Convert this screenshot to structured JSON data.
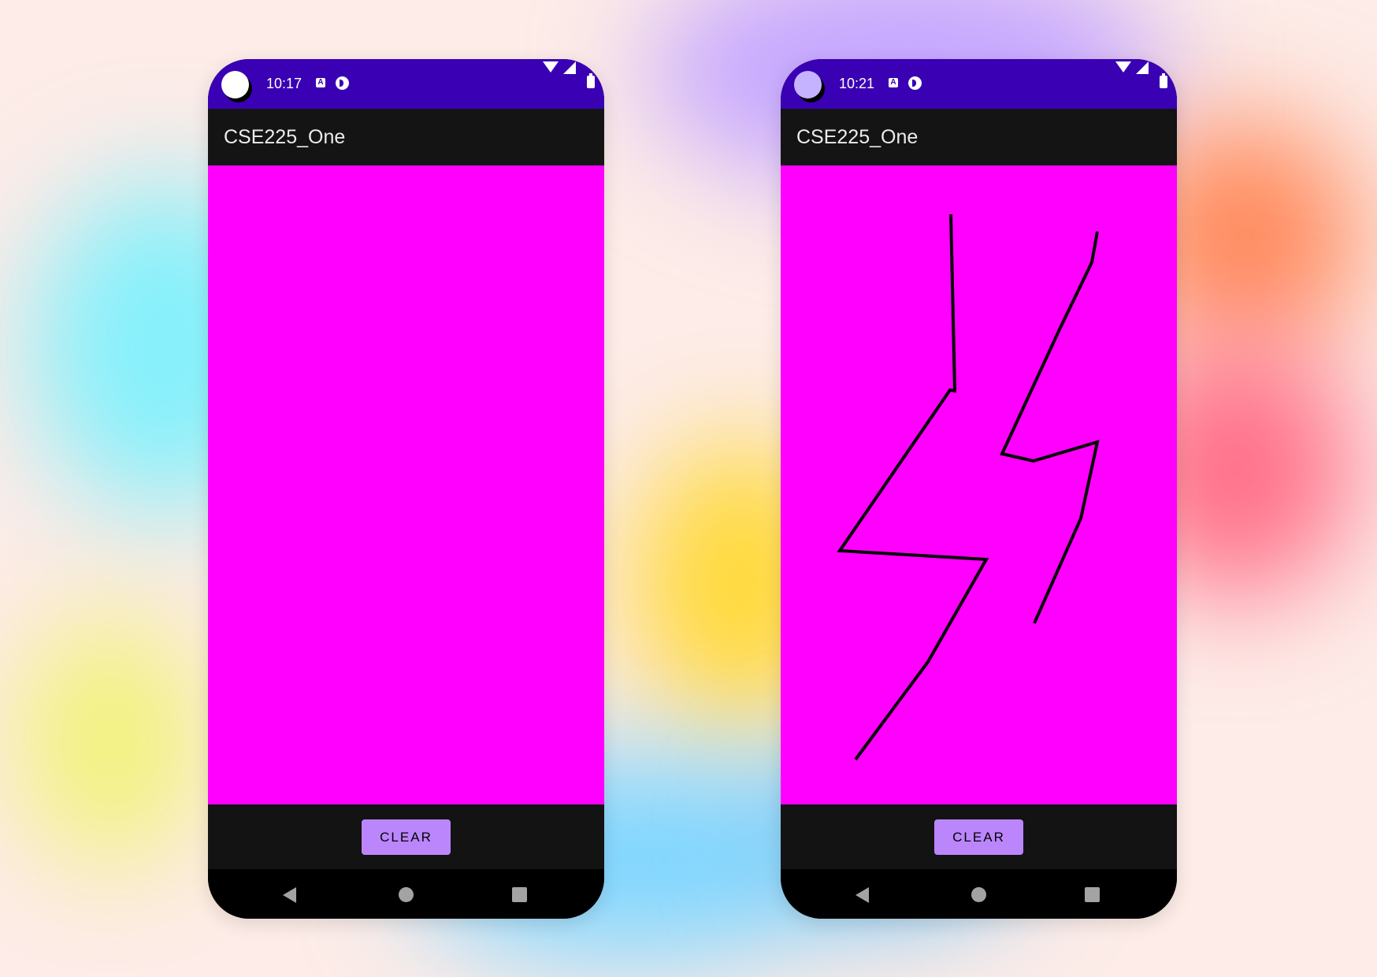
{
  "phones": [
    {
      "status_bar": {
        "time": "10:17",
        "notification_a": "A"
      },
      "app_bar": {
        "title": "CSE225_One"
      },
      "canvas": {
        "background": "#ff00ff",
        "drawing": "empty"
      },
      "bottom": {
        "clear_label": "CLEAR"
      },
      "nav": [
        "back-icon",
        "home-icon",
        "recents-icon"
      ]
    },
    {
      "status_bar": {
        "time": "10:21",
        "notification_a": "A"
      },
      "app_bar": {
        "title": "CSE225_One"
      },
      "canvas": {
        "background": "#ff00ff",
        "drawing": "lightning-bolt-stroke",
        "stroke_color": "#000000"
      },
      "bottom": {
        "clear_label": "CLEAR"
      },
      "nav": [
        "back-icon",
        "home-icon",
        "recents-icon"
      ]
    }
  ],
  "colors": {
    "status_bar": "#3a00b4",
    "app_bar": "#141414",
    "canvas": "#ff00ff",
    "button": "#bb86fc",
    "nav_bar": "#000000"
  }
}
